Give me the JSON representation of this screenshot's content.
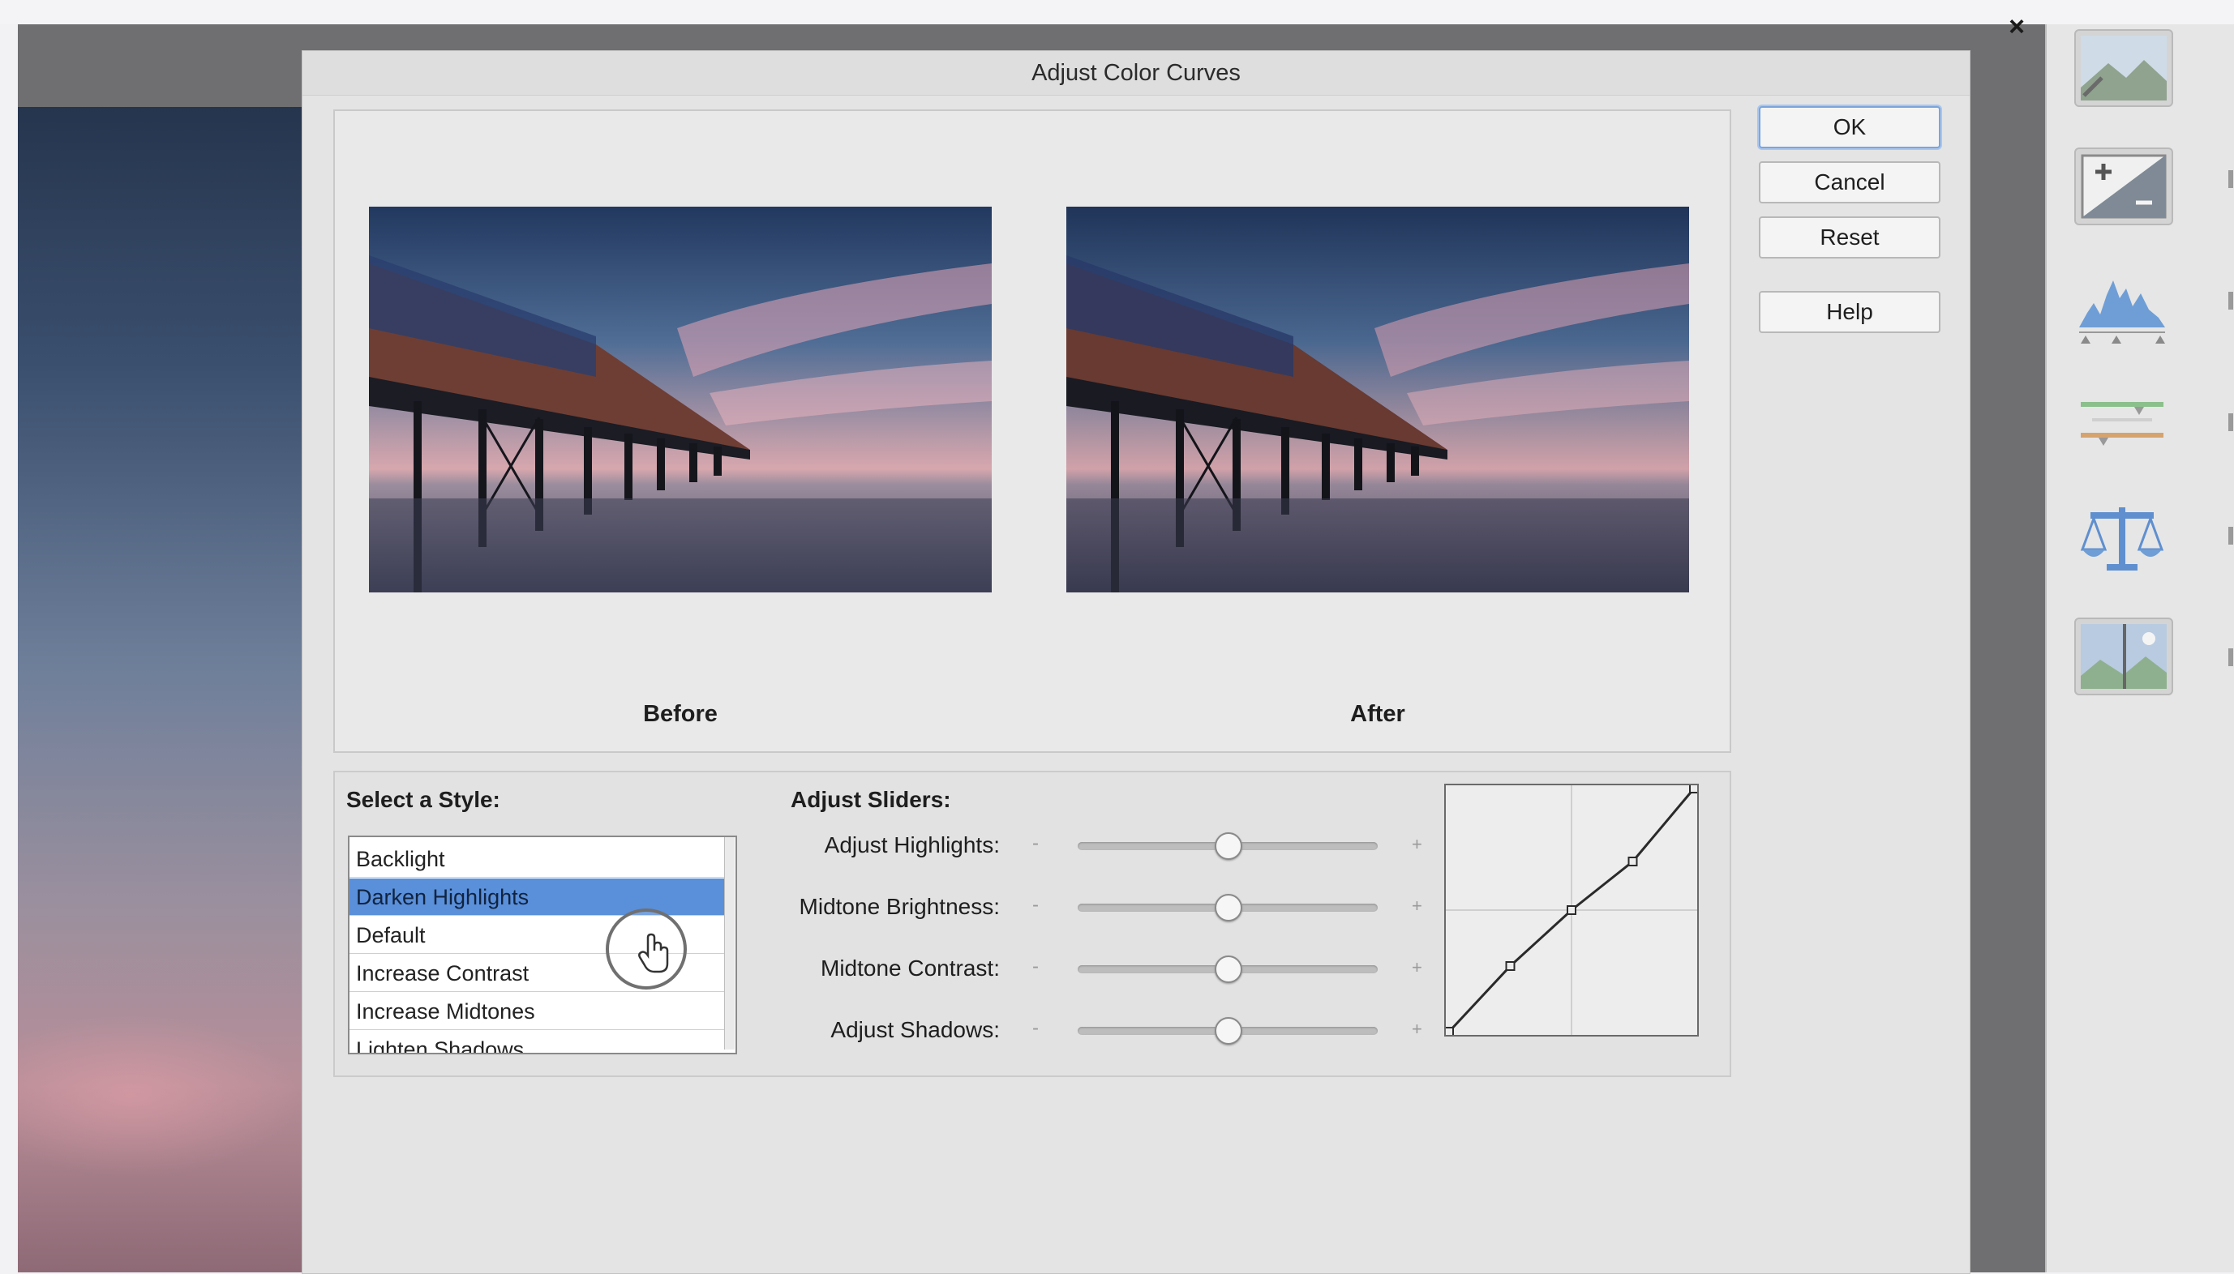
{
  "dialog": {
    "title": "Adjust Color Curves",
    "close_icon": "close-icon"
  },
  "previews": {
    "before_label": "Before",
    "after_label": "After"
  },
  "buttons": {
    "ok": "OK",
    "cancel": "Cancel",
    "reset": "Reset",
    "help": "Help"
  },
  "style_section": {
    "label": "Select a Style:",
    "items": [
      {
        "label": "Backlight",
        "selected": false
      },
      {
        "label": "Darken Highlights",
        "selected": true
      },
      {
        "label": "Default",
        "selected": false
      },
      {
        "label": "Increase Contrast",
        "selected": false
      },
      {
        "label": "Increase Midtones",
        "selected": false
      },
      {
        "label": "Lighten Shadows",
        "selected": false
      }
    ]
  },
  "sliders_section": {
    "label": "Adjust Sliders:",
    "minus_symbol": "-",
    "plus_symbol": "+",
    "sliders": [
      {
        "label": "Adjust Highlights:",
        "value": 0.5
      },
      {
        "label": "Midtone Brightness:",
        "value": 0.5
      },
      {
        "label": "Midtone Contrast:",
        "value": 0.5
      },
      {
        "label": "Adjust Shadows:",
        "value": 0.5
      }
    ]
  },
  "curve": {
    "points": [
      [
        0,
        0
      ],
      [
        0.25,
        0.27
      ],
      [
        0.5,
        0.5
      ],
      [
        0.75,
        0.7
      ],
      [
        1,
        1
      ]
    ]
  },
  "side_panel_icons": [
    "landscape-icon",
    "exposure-icon",
    "histogram-icon",
    "color-bars-icon",
    "balance-scale-icon",
    "before-after-icon"
  ],
  "colors": {
    "dialog_bg": "#e4e4e4",
    "selection": "#5a8fd9",
    "app_bg": "#6f6f71"
  }
}
